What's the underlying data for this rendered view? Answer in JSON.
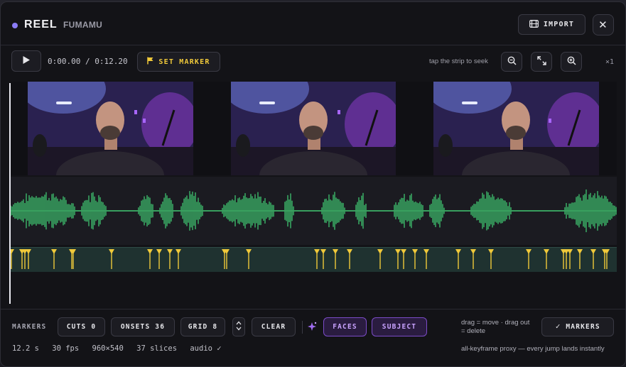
{
  "header": {
    "brand": "REEL",
    "project": "FUMAMU",
    "import_label": "IMPORT",
    "close_glyph": "✕"
  },
  "toolbar": {
    "time_current": "0:00.00",
    "time_sep": " / ",
    "time_total": "0:12.20",
    "set_marker_label": "SET MARKER",
    "seek_hint": "tap the strip to seek",
    "zoom_level": "×1"
  },
  "timeline": {
    "frame_count": 3,
    "marker_count": 36,
    "colors": {
      "waveform": "#3db86a",
      "marker": "#f0c93a",
      "marker_track": "#1f3230"
    }
  },
  "footer": {
    "markers_label": "MARKERS",
    "cuts_label": "CUTS 0",
    "onsets_label": "ONSETS 36",
    "grid_label": "GRID 8",
    "clear_label": "CLEAR",
    "faces_label": "FACES",
    "subject_label": "SUBJECT",
    "drag_hint_line1": "drag = move · drag out",
    "drag_hint_line2": "= delete",
    "markers_toggle_label": "MARKERS",
    "check_glyph": "✓",
    "stats": {
      "duration": "12.2 s",
      "fps": "30 fps",
      "resolution": "960×540",
      "slices": "37 slices",
      "audio": "audio ✓"
    },
    "proxy_note": "all-keyframe proxy — every jump lands instantly"
  }
}
